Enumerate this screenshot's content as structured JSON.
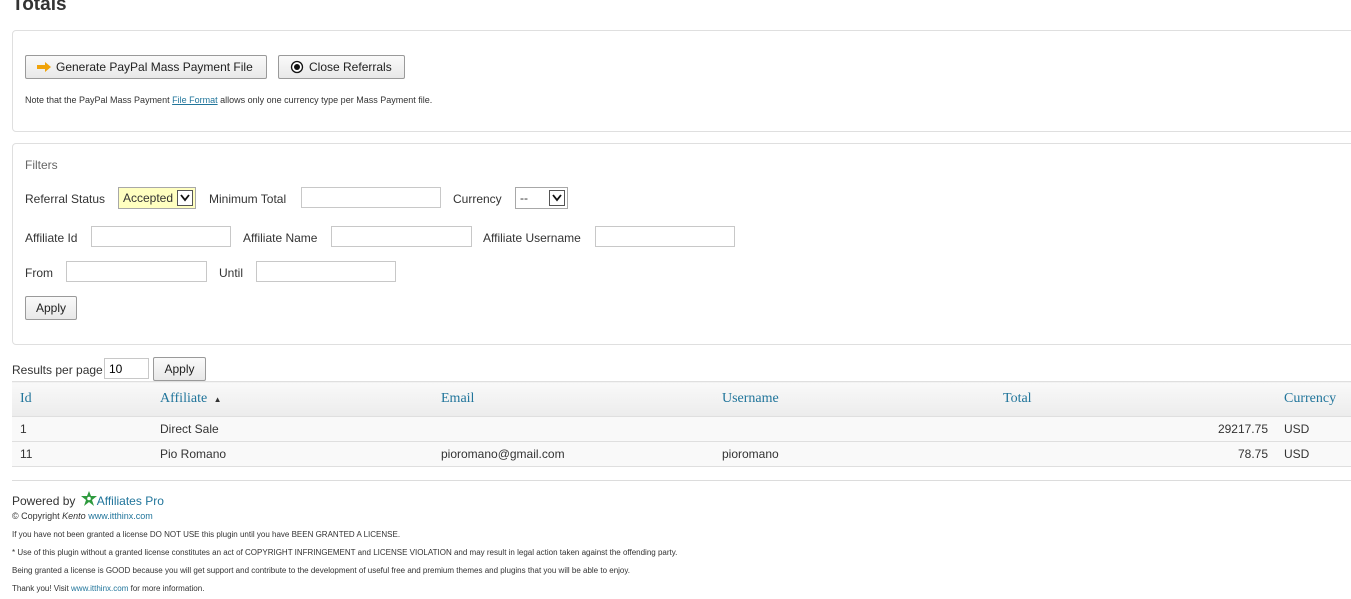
{
  "page_title": "Totals",
  "actions": {
    "generate_label": "Generate PayPal Mass Payment File",
    "close_label": "Close Referrals",
    "note_prefix": "Note that the PayPal Mass Payment",
    "note_link": "File Format",
    "note_suffix": "allows only one currency type per Mass Payment file."
  },
  "filters": {
    "legend": "Filters",
    "referral_status_label": "Referral Status",
    "referral_status_value": "Accepted",
    "minimum_total_label": "Minimum Total",
    "minimum_total_value": "",
    "currency_label": "Currency",
    "currency_value": "--",
    "affiliate_id_label": "Affiliate Id",
    "affiliate_name_label": "Affiliate Name",
    "affiliate_username_label": "Affiliate Username",
    "from_label": "From",
    "until_label": "Until",
    "apply_label": "Apply"
  },
  "pagination": {
    "results_label": "Results per page",
    "results_value": "10",
    "apply_label": "Apply"
  },
  "table": {
    "columns": [
      "Id",
      "Affiliate",
      "Email",
      "Username",
      "Total",
      "Currency"
    ],
    "sort_indicator": "▲",
    "rows": [
      {
        "id": "1",
        "affiliate": "Direct Sale",
        "email": "",
        "username": "",
        "total": "29217.75",
        "currency": "USD"
      },
      {
        "id": "11",
        "affiliate": "Pio Romano",
        "email": "pioromano@gmail.com",
        "username": "pioromano",
        "total": "78.75",
        "currency": "USD"
      }
    ]
  },
  "footer": {
    "powered_by": "Powered by",
    "brand": "Affiliates Pro",
    "copyright_prefix": "© Copyright",
    "copyright_author": "Kento",
    "copyright_link": "www.itthinx.com",
    "line1": "If you have not been granted a license DO NOT USE this plugin until you have BEEN GRANTED A LICENSE.",
    "line2": "* Use of this plugin without a granted license constitutes an act of COPYRIGHT INFRINGEMENT and LICENSE VIOLATION and may result in legal action taken against the offending party.",
    "line3": "Being granted a license is GOOD because you will get support and contribute to the development of useful free and premium themes and plugins that you will be able to enjoy.",
    "thanks_prefix": "Thank you! Visit",
    "thanks_link": "www.itthinx.com",
    "thanks_suffix": "for more information."
  },
  "colors": {
    "link": "#21759b",
    "select_highlight": "#ffffc0",
    "arrow_icon": "#f0a30a",
    "logo_green": "#2e9a3e"
  }
}
